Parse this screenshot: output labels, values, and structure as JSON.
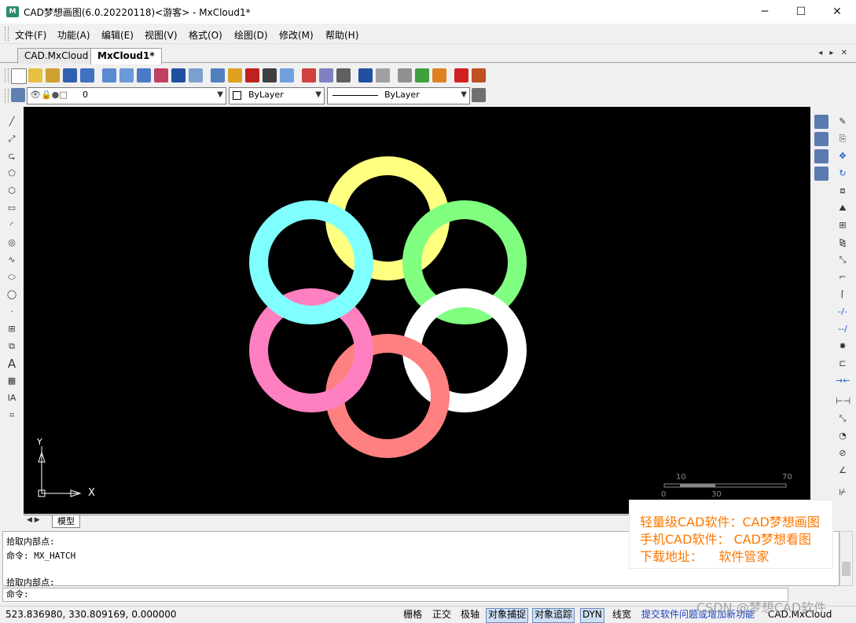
{
  "window": {
    "title": "CAD梦想画图(6.0.20220118)<游客> - MxCloud1*",
    "icon_label": "M",
    "minimize": "─",
    "maximize": "☐",
    "close": "✕"
  },
  "menu": [
    "文件(F)",
    "功能(A)",
    "编辑(E)",
    "视图(V)",
    "格式(O)",
    "绘图(D)",
    "修改(M)",
    "帮助(H)"
  ],
  "tabs": [
    "CAD.MxCloud",
    "MxCloud1*"
  ],
  "tab_nav": "◂ ▸ ✕",
  "properties": {
    "layer": "0",
    "color": "ByLayer",
    "linetype": "ByLayer"
  },
  "canvas": {
    "background": "#000000",
    "axis_x": "X",
    "axis_y": "Y",
    "scale_labels": [
      "10",
      "70",
      "0",
      "30"
    ],
    "rings": [
      {
        "color": "#ffff80"
      },
      {
        "color": "#80ff80"
      },
      {
        "color": "#ffffff"
      },
      {
        "color": "#ff8080"
      },
      {
        "color": "#ff80c0"
      },
      {
        "color": "#80ffff"
      }
    ]
  },
  "layout_tab": "模型",
  "command": {
    "history": [
      "拾取内部点:",
      "命令: MX_HATCH",
      "",
      "拾取内部点:"
    ],
    "prompt": "命令:"
  },
  "status": {
    "coords": "523.836980, 330.809169, 0.000000",
    "toggles": [
      {
        "label": "栅格",
        "on": false
      },
      {
        "label": "正交",
        "on": false
      },
      {
        "label": "极轴",
        "on": false
      },
      {
        "label": "对象捕捉",
        "on": true
      },
      {
        "label": "对象追踪",
        "on": true
      },
      {
        "label": "DYN",
        "on": true
      },
      {
        "label": "线宽",
        "on": false
      }
    ],
    "link": "提交软件问题或增加新功能",
    "brand": "CAD.MxCloud"
  },
  "ad": {
    "line1": "轻量级CAD软件：CAD梦想画图",
    "line2": "手机CAD软件： CAD梦想看图",
    "line3": "下载地址：    软件管家"
  },
  "watermark": "CSDN @梦想CAD软件"
}
